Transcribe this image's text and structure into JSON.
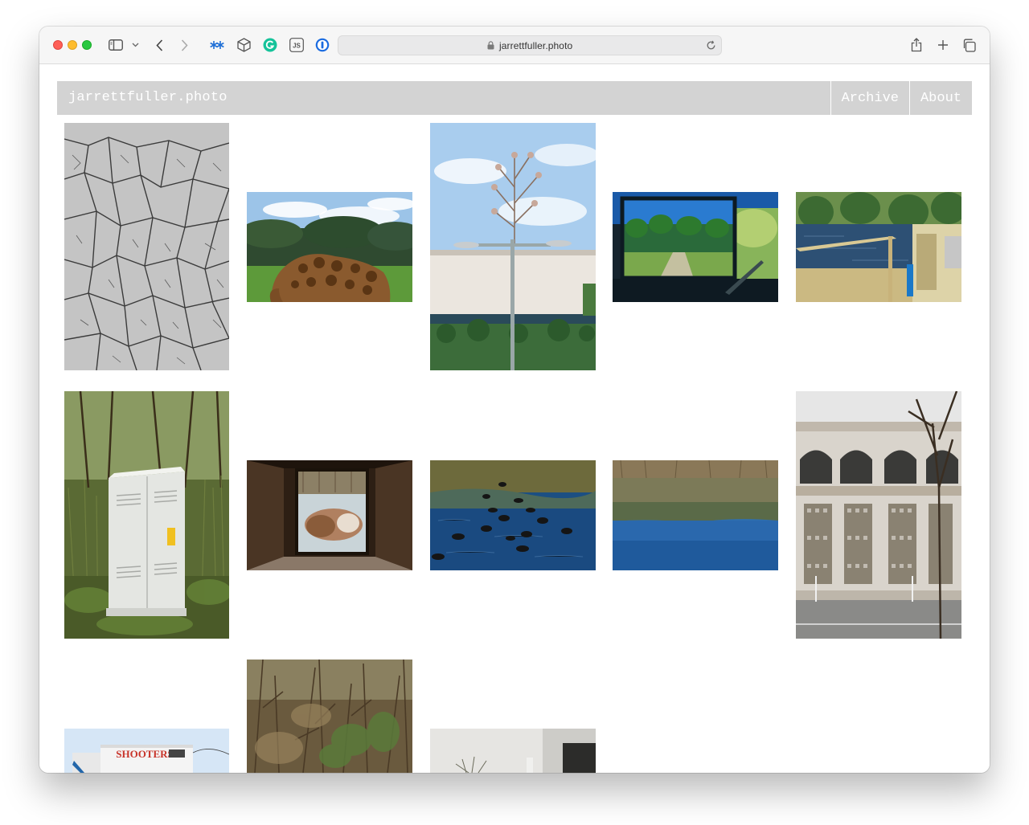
{
  "browser": {
    "url": "jarrettfuller.photo",
    "extension_js_label": "JS"
  },
  "site": {
    "title": "jarrettfuller.photo",
    "nav": [
      {
        "label": "Archive"
      },
      {
        "label": "About"
      }
    ],
    "sign_text": "SHOOTERS"
  },
  "icons": {
    "sidebar": "sidebar-icon",
    "back": "chevron-left-icon",
    "forward": "chevron-right-icon",
    "share": "share-icon",
    "new_tab": "plus-icon",
    "tabs": "tab-overview-icon"
  }
}
